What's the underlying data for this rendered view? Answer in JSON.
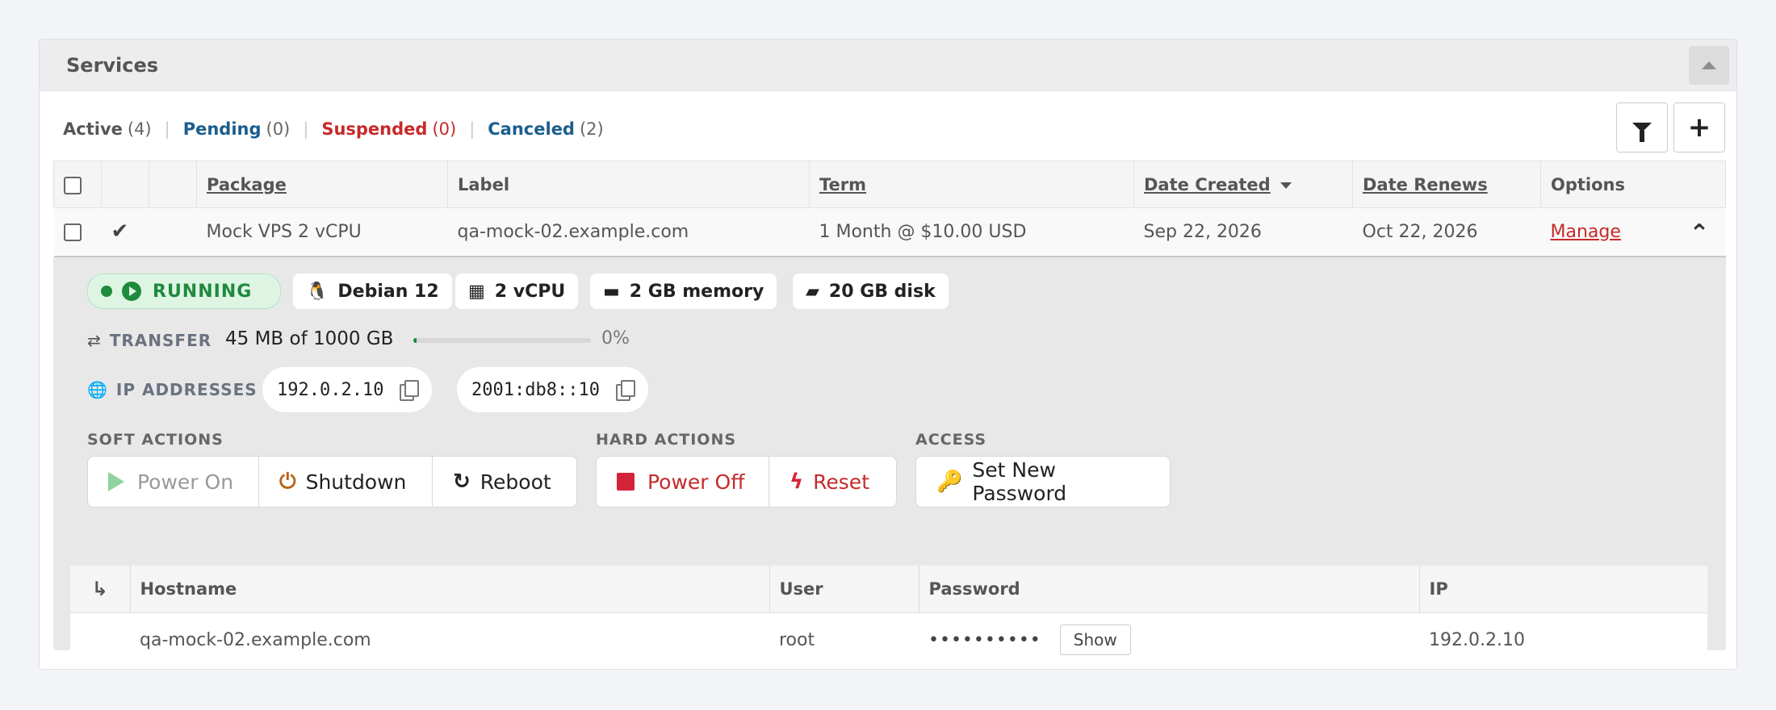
{
  "panel": {
    "title": "Services"
  },
  "filters": [
    {
      "label": "Active",
      "count": "(4)"
    },
    {
      "label": "Pending",
      "count": "(0)"
    },
    {
      "label": "Suspended",
      "count": "(0)"
    },
    {
      "label": "Canceled",
      "count": "(2)"
    }
  ],
  "filter_separator": "|",
  "toolbar": {
    "filter_icon": "filter-icon",
    "add_icon": "plus-icon",
    "add_glyph": "+"
  },
  "table": {
    "headers": {
      "package": "Package",
      "label": "Label",
      "term": "Term",
      "date_created": "Date Created",
      "date_renews": "Date Renews",
      "options": "Options"
    },
    "row": {
      "check_glyph": "✔",
      "package": "Mock VPS 2 vCPU",
      "label": "qa-mock-02.example.com",
      "term": "1 Month @ $10.00 USD",
      "date_created": "Sep 22, 2026",
      "date_renews": "Oct 22, 2026",
      "manage": "Manage",
      "collapse_glyph": "⌃"
    }
  },
  "detail": {
    "status": "RUNNING",
    "os": {
      "label": "Debian 12",
      "glyph": "🐧"
    },
    "cpu": {
      "label": "2 vCPU",
      "glyph": "▦"
    },
    "memory": {
      "label": "2 GB memory",
      "glyph": "▬"
    },
    "disk": {
      "label": "20 GB disk",
      "glyph": "▰"
    },
    "transfer": {
      "label": "TRANSFER",
      "glyph": "⇄",
      "value": "45 MB of 1000 GB",
      "percent_text": "0%",
      "fill_percent": 0.5
    },
    "ip": {
      "label": "IP ADDRESSES",
      "glyph": "🌐",
      "v4": "192.0.2.10",
      "v6": "2001:db8::10"
    },
    "soft_actions": {
      "label": "SOFT ACTIONS",
      "power_on": "Power On",
      "shutdown": "Shutdown",
      "shutdown_glyph": "⏻",
      "reboot": "Reboot",
      "reboot_glyph": "↻"
    },
    "hard_actions": {
      "label": "HARD ACTIONS",
      "power_off": "Power Off",
      "reset": "Reset",
      "reset_glyph": "ϟ"
    },
    "access": {
      "label": "ACCESS",
      "set_password": "Set New Password",
      "key_glyph": "🔑"
    },
    "credentials": {
      "enter_glyph": "↳",
      "headers": {
        "hostname": "Hostname",
        "user": "User",
        "password": "Password",
        "ip": "IP"
      },
      "row": {
        "hostname": "qa-mock-02.example.com",
        "user": "root",
        "password_mask": "••••••••••",
        "show": "Show",
        "ip": "192.0.2.10"
      }
    }
  },
  "colors": {
    "green": "#1e8a3e",
    "red": "#c62a2a",
    "blue": "#1c5e8d"
  }
}
